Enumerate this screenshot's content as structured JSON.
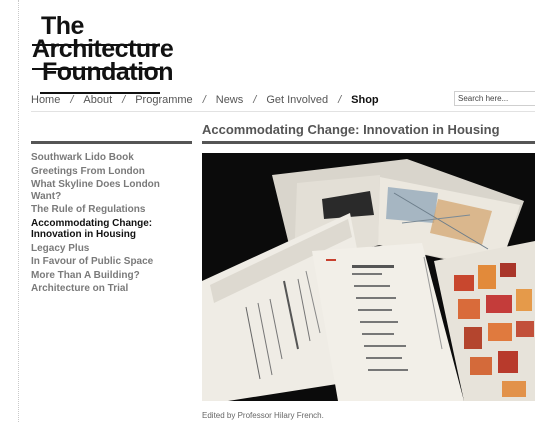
{
  "logo": {
    "line1": "The",
    "line2": "Architecture",
    "line3": "Foundation"
  },
  "nav": {
    "items": [
      {
        "label": "Home"
      },
      {
        "label": "About"
      },
      {
        "label": "Programme"
      },
      {
        "label": "News"
      },
      {
        "label": "Get Involved"
      },
      {
        "label": "Shop"
      }
    ],
    "separator": "/",
    "active": "Shop"
  },
  "search": {
    "placeholder": "Search here..."
  },
  "sidebar": {
    "items": [
      {
        "label": "Southwark Lido Book"
      },
      {
        "label": "Greetings From London"
      },
      {
        "label": "What Skyline Does London Want?"
      },
      {
        "label": "The Rule of Regulations"
      },
      {
        "label": "Accommodating Change: Innovation in Housing"
      },
      {
        "label": "Legacy Plus"
      },
      {
        "label": "In Favour of Public Space"
      },
      {
        "label": "More Than A Building?"
      },
      {
        "label": "Architecture on Trial"
      }
    ],
    "current": "Accommodating Change: Innovation in Housing"
  },
  "main": {
    "title": "Accommodating Change: Innovation in Housing",
    "caption": "Edited by Professor Hilary French."
  },
  "colors": {
    "text_dark": "#111111",
    "text_grey": "#7a7a7a",
    "rule": "#555555",
    "photo_bg": "#0c0c0c"
  }
}
